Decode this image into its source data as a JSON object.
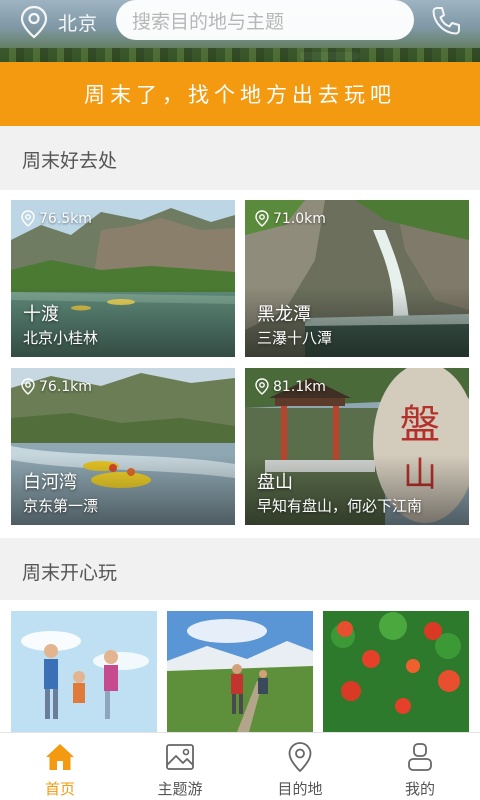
{
  "header": {
    "city": "北京",
    "search_placeholder": "搜索目的地与主题"
  },
  "banner": {
    "text": "周末了，找个地方出去玩吧"
  },
  "section_weekend_places": {
    "title": "周末好去处",
    "cards": [
      {
        "name": "十渡",
        "subtitle": "北京小桂林",
        "distance": "76.5km"
      },
      {
        "name": "黑龙潭",
        "subtitle": "三瀑十八潭",
        "distance": "71.0km"
      },
      {
        "name": "白河湾",
        "subtitle": "京东第一漂",
        "distance": "76.1km"
      },
      {
        "name": "盘山",
        "subtitle": "早知有盘山，何必下江南",
        "distance": "81.1km"
      }
    ]
  },
  "section_weekend_fun": {
    "title": "周末开心玩"
  },
  "tabbar": {
    "tabs": [
      {
        "label": "首页",
        "icon": "home-icon",
        "active": true
      },
      {
        "label": "主题游",
        "icon": "image-icon",
        "active": false
      },
      {
        "label": "目的地",
        "icon": "location-pin-icon",
        "active": false
      },
      {
        "label": "我的",
        "icon": "user-icon",
        "active": false
      }
    ]
  },
  "colors": {
    "accent": "#f39a10",
    "tab_inactive": "#555555"
  }
}
